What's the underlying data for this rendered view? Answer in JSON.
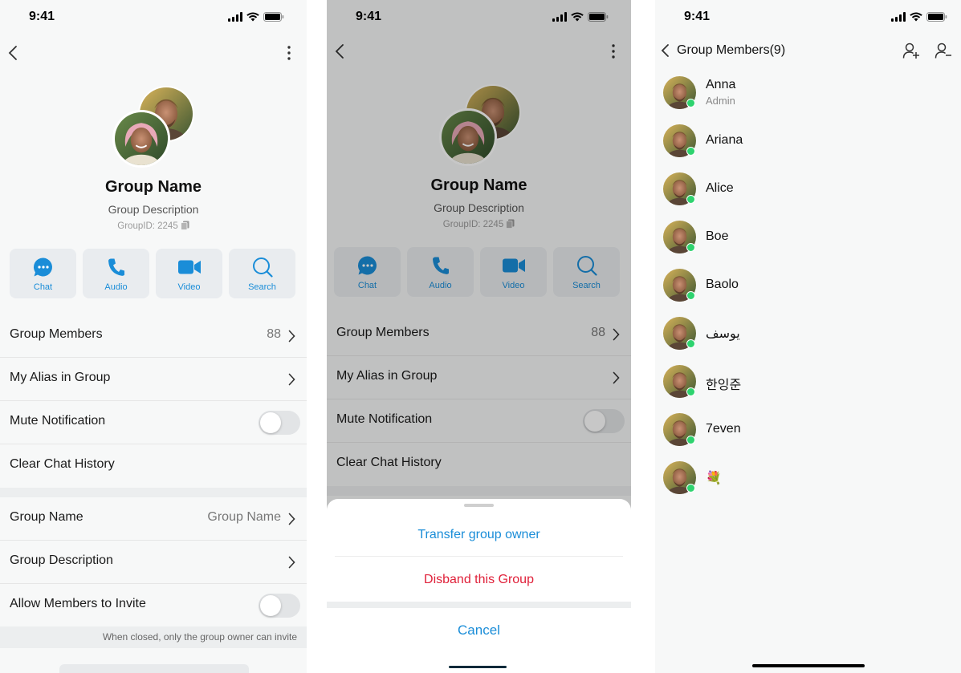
{
  "status": {
    "time": "9:41"
  },
  "screen1": {
    "group_title": "Group Name",
    "group_description": "Group Description",
    "group_id": "GroupID: 2245",
    "actions": [
      {
        "label": "Chat",
        "icon": "chat-bubble-icon"
      },
      {
        "label": "Audio",
        "icon": "phone-icon"
      },
      {
        "label": "Video",
        "icon": "video-camera-icon"
      },
      {
        "label": "Search",
        "icon": "search-icon"
      }
    ],
    "rows": {
      "members": {
        "label": "Group Members",
        "value": "88"
      },
      "alias": {
        "label": "My Alias in Group"
      },
      "mute": {
        "label": "Mute Notification",
        "on": false
      },
      "clear": {
        "label": "Clear Chat History"
      },
      "name": {
        "label": "Group Name",
        "value": "Group Name"
      },
      "description": {
        "label": "Group Description"
      },
      "invite": {
        "label": "Allow Members to Invite",
        "on": false
      }
    },
    "invite_hint": "When closed, only the group owner can invite"
  },
  "sheet": {
    "transfer": "Transfer group owner",
    "disband": "Disband this Group",
    "cancel": "Cancel"
  },
  "members_screen": {
    "title": "Group Members(9)",
    "members": [
      {
        "name": "Anna",
        "role": "Admin"
      },
      {
        "name": "Ariana"
      },
      {
        "name": "Alice"
      },
      {
        "name": "Boe"
      },
      {
        "name": "Baolo"
      },
      {
        "name": "يوسف"
      },
      {
        "name": "한잉준"
      },
      {
        "name": "7even"
      },
      {
        "name": "💐"
      }
    ]
  },
  "colors": {
    "accent": "#1a8dd8",
    "danger": "#e0213a",
    "online": "#2ed36f"
  }
}
